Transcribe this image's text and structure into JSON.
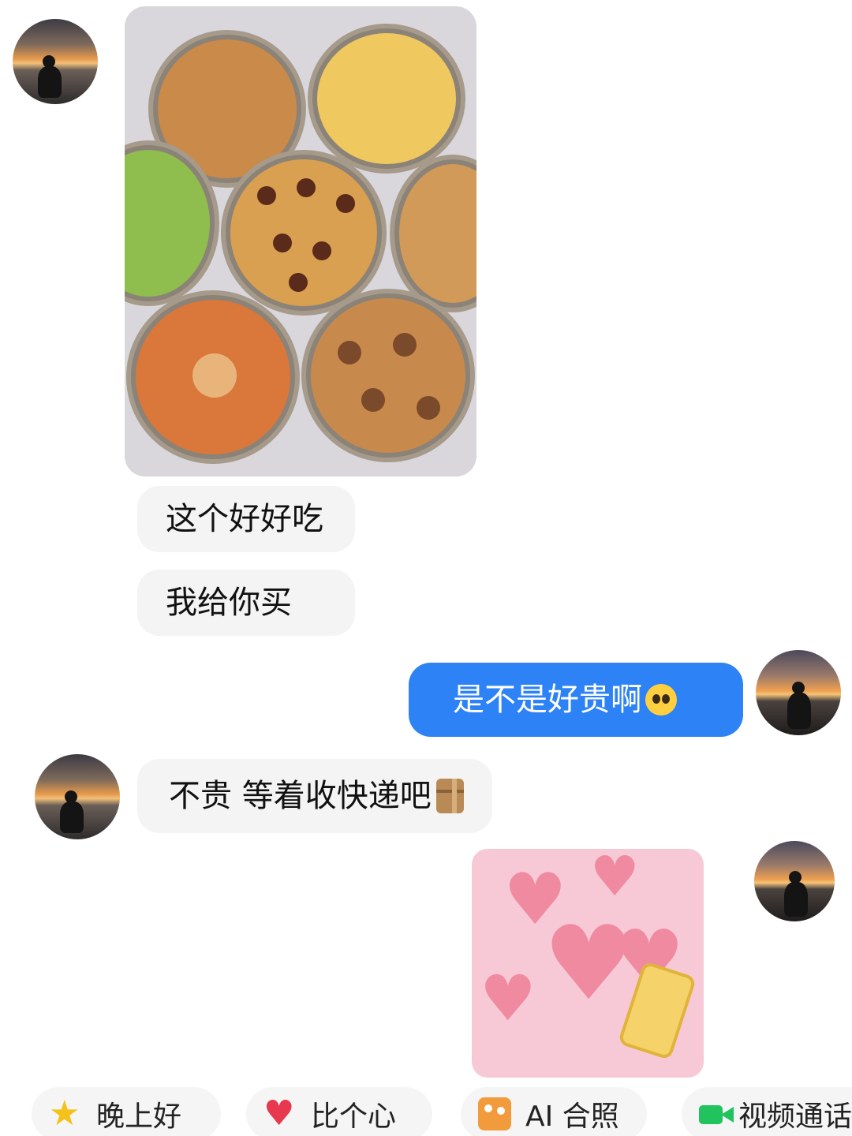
{
  "messages": [
    {
      "from": "them",
      "type": "image",
      "description_icon": "cookie-tins-photo"
    },
    {
      "from": "them",
      "type": "text",
      "text": "这个好好吃"
    },
    {
      "from": "them",
      "type": "text",
      "text": "我给你买"
    },
    {
      "from": "me",
      "type": "text",
      "text": "是不是好贵啊",
      "emoji": "pleading-face-icon"
    },
    {
      "from": "them",
      "type": "text",
      "text": "不贵 等着收快递吧",
      "emoji": "package-icon"
    },
    {
      "from": "me",
      "type": "sticker",
      "description_icon": "hearts-sticker"
    }
  ],
  "quick_actions": [
    {
      "icon": "star-icon",
      "label": "晚上好"
    },
    {
      "icon": "heart-icon",
      "label": "比个心"
    },
    {
      "icon": "ai-photo-icon",
      "label": "AI 合照"
    },
    {
      "icon": "video-call-icon",
      "label": "视频通话"
    }
  ],
  "colors": {
    "outgoing_bubble": "#2d82f5",
    "incoming_bubble": "#f4f4f5",
    "background": "#ffffff"
  }
}
